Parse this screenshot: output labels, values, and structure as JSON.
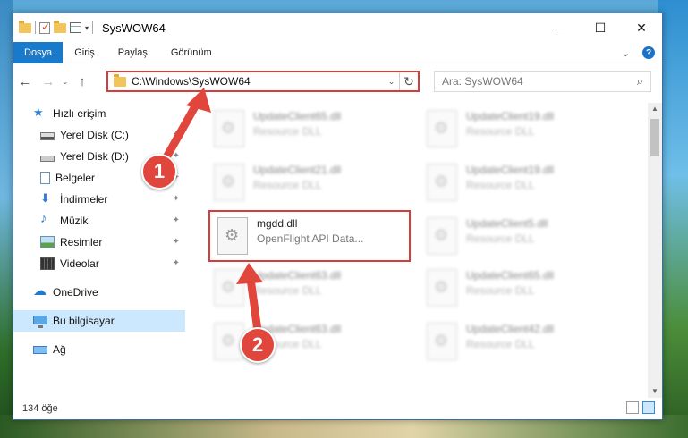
{
  "window": {
    "title": "SysWOW64",
    "controls": {
      "minimize": "—",
      "maximize": "☐",
      "close": "✕"
    }
  },
  "ribbon": {
    "tabs": [
      "Dosya",
      "Giriş",
      "Paylaş",
      "Görünüm"
    ],
    "expand": "⌄",
    "help": "?"
  },
  "navigation": {
    "back": "←",
    "forward": "→",
    "recent": "⌄",
    "up": "↑",
    "address": "C:\\Windows\\SysWOW64",
    "address_dropdown": "⌄",
    "refresh": "↻",
    "search_placeholder": "Ara: SysWOW64",
    "search_icon": "⌕"
  },
  "sidebar": {
    "items": [
      {
        "label": "Hızlı erişim",
        "icon": "star-icon"
      },
      {
        "label": "Yerel Disk (C:)",
        "icon": "drive-icon",
        "pinned": true
      },
      {
        "label": "Yerel Disk (D:)",
        "icon": "drive-icon",
        "pinned": true
      },
      {
        "label": "Belgeler",
        "icon": "documents-icon",
        "pinned": true
      },
      {
        "label": "İndirmeler",
        "icon": "downloads-icon",
        "pinned": true
      },
      {
        "label": "Müzik",
        "icon": "music-icon",
        "pinned": true
      },
      {
        "label": "Resimler",
        "icon": "pictures-icon",
        "pinned": true
      },
      {
        "label": "Videolar",
        "icon": "videos-icon",
        "pinned": true
      },
      {
        "label": "OneDrive",
        "icon": "onedrive-icon"
      },
      {
        "label": "Bu bilgisayar",
        "icon": "computer-icon",
        "selected": true
      },
      {
        "label": "Ağ",
        "icon": "network-icon"
      }
    ],
    "pin_glyph": "📌"
  },
  "files": {
    "left": [
      {
        "name": "UpdateClient65.dll",
        "type": "Resource DLL"
      },
      {
        "name": "UpdateClient21.dll",
        "type": "Resource DLL"
      },
      {
        "name": "mgdd.dll",
        "type": "OpenFlight API Data..."
      },
      {
        "name": "UpdateClient63.dll",
        "type": "Resource DLL"
      },
      {
        "name": "UpdateClient63.dll",
        "type": "Resource DLL"
      }
    ],
    "right": [
      {
        "name": "UpdateClient19.dll",
        "type": "Resource DLL"
      },
      {
        "name": "UpdateClient19.dll",
        "type": "Resource DLL"
      },
      {
        "name": "UpdateClient5.dll",
        "type": "Resource DLL"
      },
      {
        "name": "UpdateClient65.dll",
        "type": "Resource DLL"
      },
      {
        "name": "UpdateClient42.dll",
        "type": "Resource DLL"
      }
    ]
  },
  "status": {
    "item_count": "134 öğe"
  },
  "annotations": {
    "badge1": "1",
    "badge2": "2",
    "color": "#e0463c"
  }
}
